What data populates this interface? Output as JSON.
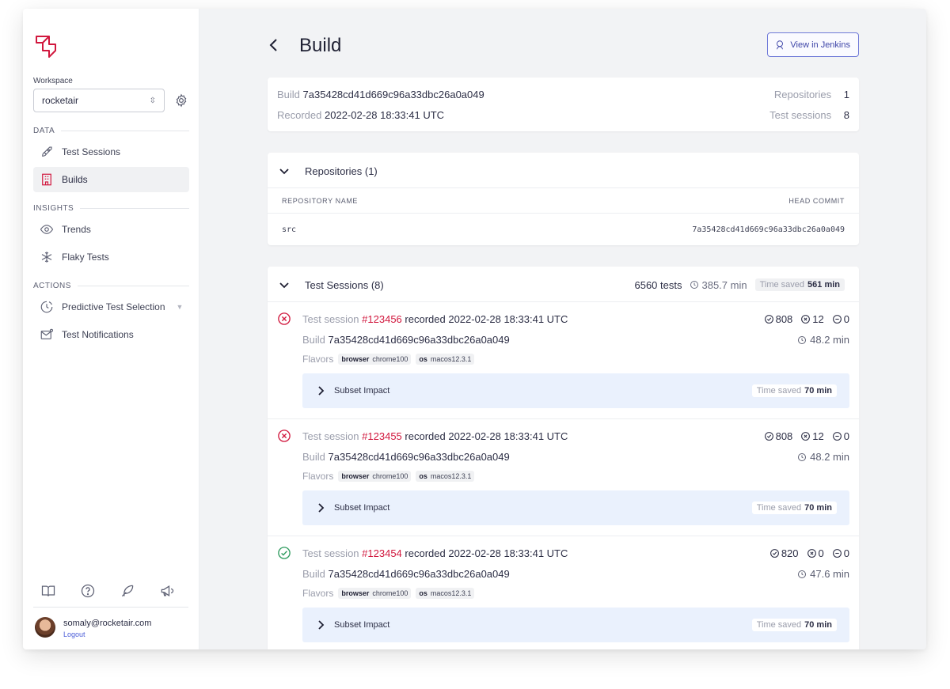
{
  "sidebar": {
    "workspace_label": "Workspace",
    "workspace_value": "rocketair",
    "sections": {
      "data": "DATA",
      "insights": "INSIGHTS",
      "actions": "ACTIONS"
    },
    "items": {
      "test_sessions": "Test Sessions",
      "builds": "Builds",
      "trends": "Trends",
      "flaky_tests": "Flaky Tests",
      "predictive": "Predictive Test Selection",
      "notifications": "Test Notifications"
    },
    "user": {
      "email": "somaly@rocketair.com",
      "logout": "Logout"
    }
  },
  "header": {
    "title": "Build",
    "jenkins_button": "View in Jenkins"
  },
  "summary": {
    "build_label": "Build",
    "build_value": "7a35428cd41d669c96a33dbc26a0a049",
    "recorded_label": "Recorded",
    "recorded_value": "2022-02-28 18:33:41 UTC",
    "repositories_label": "Repositories",
    "repositories_value": "1",
    "sessions_label": "Test sessions",
    "sessions_value": "8"
  },
  "repositories": {
    "title": "Repositories (1)",
    "col_name": "REPOSITORY NAME",
    "col_commit": "HEAD COMMIT",
    "rows": [
      {
        "name": "src",
        "commit": "7a35428cd41d669c96a33dbc26a0a049"
      }
    ]
  },
  "test_sessions": {
    "title": "Test Sessions (8)",
    "tests": "6560 tests",
    "duration": "385.7 min",
    "time_saved_label": "Time saved",
    "time_saved_value": "561 min",
    "sessions": [
      {
        "status": "failed",
        "prefix": "Test session",
        "id": "#123456",
        "recorded": "recorded 2022-02-28 18:33:41 UTC",
        "build_label": "Build",
        "build": "7a35428cd41d669c96a33dbc26a0a049",
        "flavors_label": "Flavors",
        "flavor1_key": "browser",
        "flavor1_val": "chrome100",
        "flavor2_key": "os",
        "flavor2_val": "macos12.3.1",
        "passed": "808",
        "failed": "12",
        "skipped": "0",
        "duration": "48.2 min",
        "subset_label": "Subset Impact",
        "saved_label": "Time saved",
        "saved_value": "70 min"
      },
      {
        "status": "failed",
        "prefix": "Test session",
        "id": "#123455",
        "recorded": "recorded 2022-02-28 18:33:41 UTC",
        "build_label": "Build",
        "build": "7a35428cd41d669c96a33dbc26a0a049",
        "flavors_label": "Flavors",
        "flavor1_key": "browser",
        "flavor1_val": "chrome100",
        "flavor2_key": "os",
        "flavor2_val": "macos12.3.1",
        "passed": "808",
        "failed": "12",
        "skipped": "0",
        "duration": "48.2 min",
        "subset_label": "Subset Impact",
        "saved_label": "Time saved",
        "saved_value": "70 min"
      },
      {
        "status": "passed",
        "prefix": "Test session",
        "id": "#123454",
        "recorded": "recorded 2022-02-28 18:33:41 UTC",
        "build_label": "Build",
        "build": "7a35428cd41d669c96a33dbc26a0a049",
        "flavors_label": "Flavors",
        "flavor1_key": "browser",
        "flavor1_val": "chrome100",
        "flavor2_key": "os",
        "flavor2_val": "macos12.3.1",
        "passed": "820",
        "failed": "0",
        "skipped": "0",
        "duration": "47.6 min",
        "subset_label": "Subset Impact",
        "saved_label": "Time saved",
        "saved_value": "70 min"
      }
    ]
  },
  "colors": {
    "brand": "#d1183e",
    "link": "#4b5dd8",
    "success": "#2e9b5e",
    "subset_bg": "#eaf1fd"
  }
}
